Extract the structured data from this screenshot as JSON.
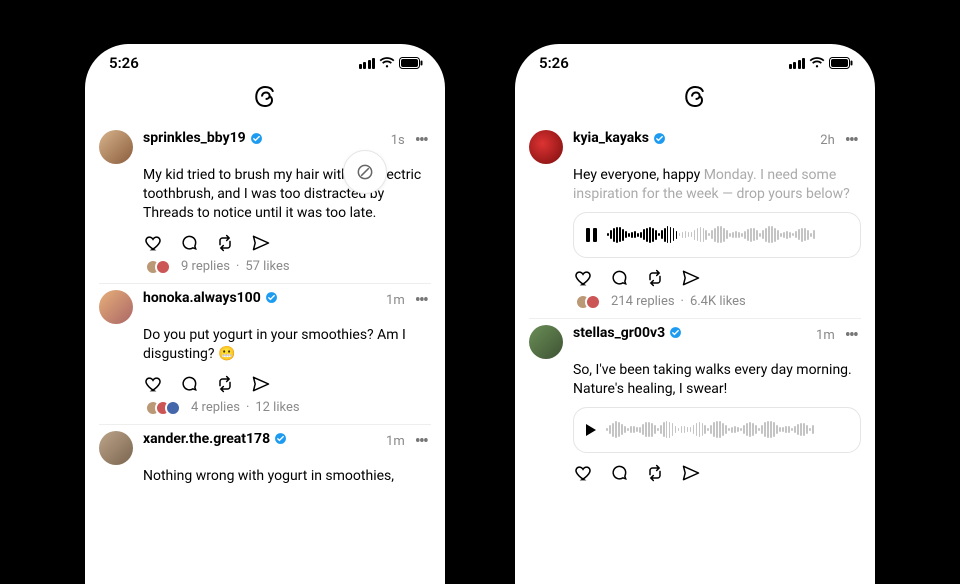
{
  "statusbar": {
    "time": "5:26"
  },
  "phoneA": {
    "posts": [
      {
        "username": "sprinkles_bby19",
        "time": "1s",
        "body": "My kid tried to brush my hair with the electric toothbrush, and I was too distracted by Threads to notice until it was too late.",
        "replies": "9 replies",
        "likes": "57 likes"
      },
      {
        "username": "honoka.always100",
        "time": "1m",
        "body": "Do you put yogurt in your smoothies? Am I disgusting?",
        "replies": "4 replies",
        "likes": "12 likes"
      },
      {
        "username": "xander.the.great178",
        "time": "1m",
        "body": "Nothing wrong with yogurt in smoothies,"
      }
    ]
  },
  "phoneB": {
    "posts": [
      {
        "username": "kyia_kayaks",
        "time": "2h",
        "body_pre": "Hey everyone, happy ",
        "body_fade": "Monday. I need some inspiration for the week — drop yours below?",
        "replies": "214 replies",
        "likes": "6.4K likes"
      },
      {
        "username": "stellas_gr00v3",
        "time": "1m",
        "body": "So, I've been taking walks every day morning. Nature's healing, I swear!"
      }
    ]
  }
}
